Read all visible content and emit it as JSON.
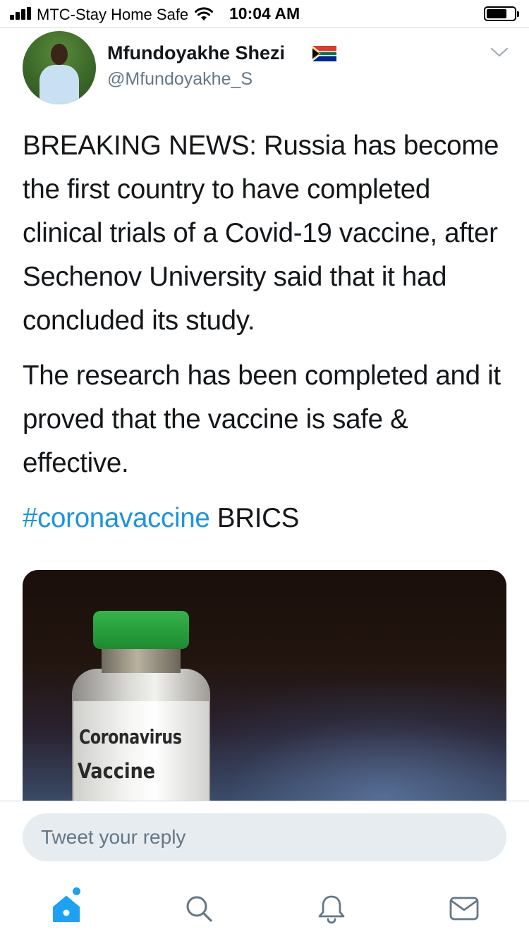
{
  "status_bar": {
    "carrier": "MTC-Stay Home Safe",
    "time": "10:04 AM"
  },
  "tweet": {
    "author_name": "Mfundoyakhe Shezi",
    "author_handle": "@Mfundoyakhe_S",
    "paragraph1": "BREAKING NEWS: Russia has become the first country to have completed clinical trials of a Covid-19 vaccine, after Sechenov University said that it had concluded its study.",
    "paragraph2": "The research has been completed and it proved that the vaccine is safe & effective.",
    "hashtag": "#coronavaccine",
    "trailing_tag": " BRICS",
    "media": {
      "label_line1": "Coronavirus",
      "label_line2": "Vaccine"
    }
  },
  "reply": {
    "placeholder": "Tweet your reply"
  },
  "tabs": [
    "home-icon",
    "search-icon",
    "notifications-icon",
    "messages-icon"
  ],
  "colors": {
    "accent": "#1da1f2",
    "hashtag": "#1b95e0",
    "secondary_text": "#657786"
  }
}
